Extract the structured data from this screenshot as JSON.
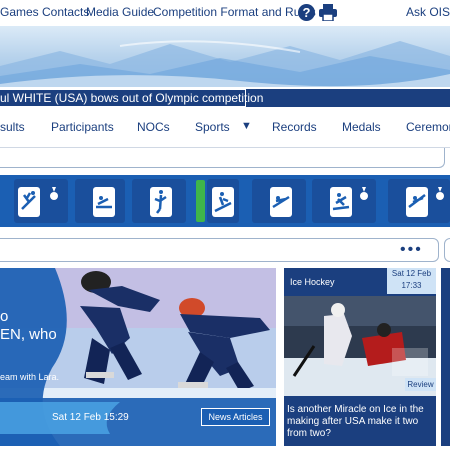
{
  "topbar": {
    "links": [
      "Games Contacts",
      "Media Guide",
      "Competition Format and Rules"
    ],
    "help_icon": "question-circle-icon",
    "print_icon": "printer-icon",
    "ask": "Ask OIS"
  },
  "ticker": {
    "text": "ul WHITE (USA) bows out of Olympic competition"
  },
  "nav": {
    "items": [
      "sults",
      "Participants",
      "NOCs",
      "Sports",
      "Records",
      "Medals",
      "Ceremoni"
    ],
    "sports_caret": "▼"
  },
  "sports_strip": {
    "icons": [
      "aerials-pictogram-icon",
      "medal-icon",
      "bobsleigh-pictogram-icon",
      "figure-skating-pictogram-icon",
      "alpine-skiing-pictogram-icon",
      "ski-jumping-pictogram-icon",
      "snowboard-pictogram-icon",
      "medal-icon",
      "ski-jumping-pictogram-icon",
      "medal-icon"
    ]
  },
  "filterbar": {
    "more": "•••"
  },
  "feature": {
    "lines": [
      "o",
      "EN, who",
      "eam with Lara."
    ],
    "date": "Sat 12 Feb 15:29",
    "button": "News Articles"
  },
  "side_card": {
    "category": "Ice Hockey",
    "date_line1": "Sat 12 Feb",
    "date_line2": "17:33",
    "badge": "Review",
    "headline": "Is another Miracle on Ice in the making after USA make it two from two?"
  },
  "colors": {
    "navy": "#1b3f7f",
    "blue": "#1b5fb3",
    "light_blue": "#cfe3f6",
    "green": "#3fb54a"
  }
}
